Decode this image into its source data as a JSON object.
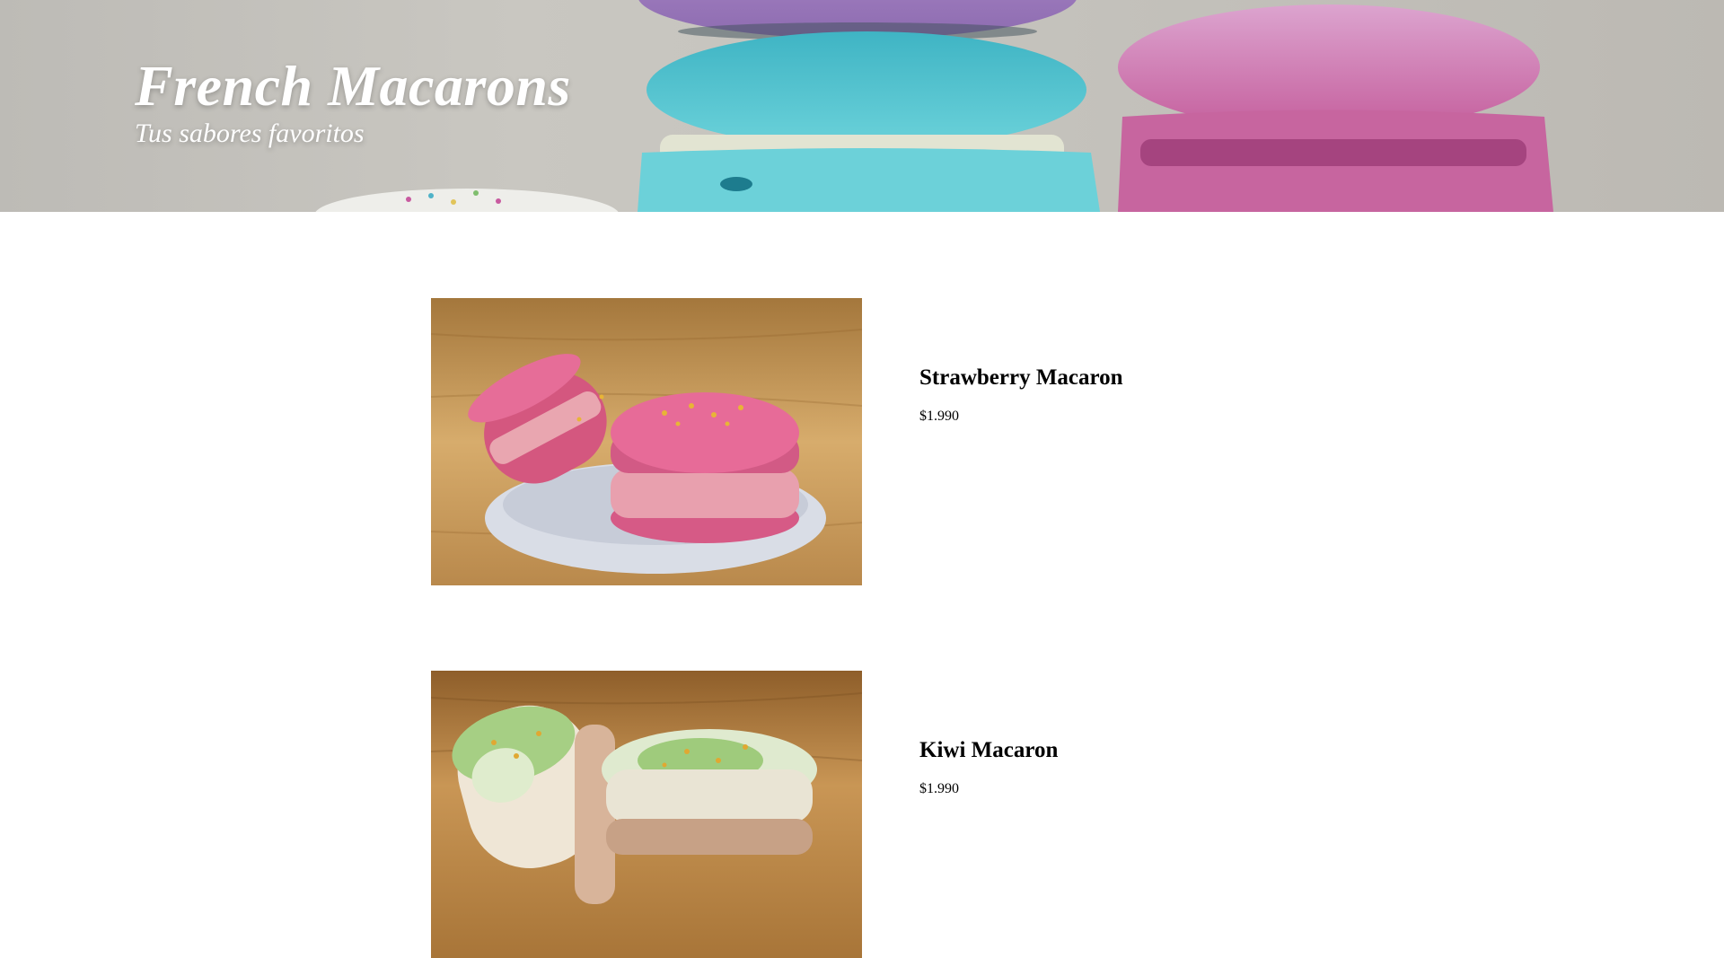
{
  "hero": {
    "title": "French Macarons",
    "subtitle": "Tus sabores favoritos",
    "image_icon": "macarons-stack-photo"
  },
  "products": [
    {
      "name": "Strawberry Macaron",
      "price": "$1.990",
      "image_icon": "pink-macarons-photo",
      "accent_color": "#e35a92"
    },
    {
      "name": "Kiwi Macaron",
      "price": "$1.990",
      "image_icon": "green-macarons-photo",
      "accent_color": "#8cc46a"
    }
  ]
}
